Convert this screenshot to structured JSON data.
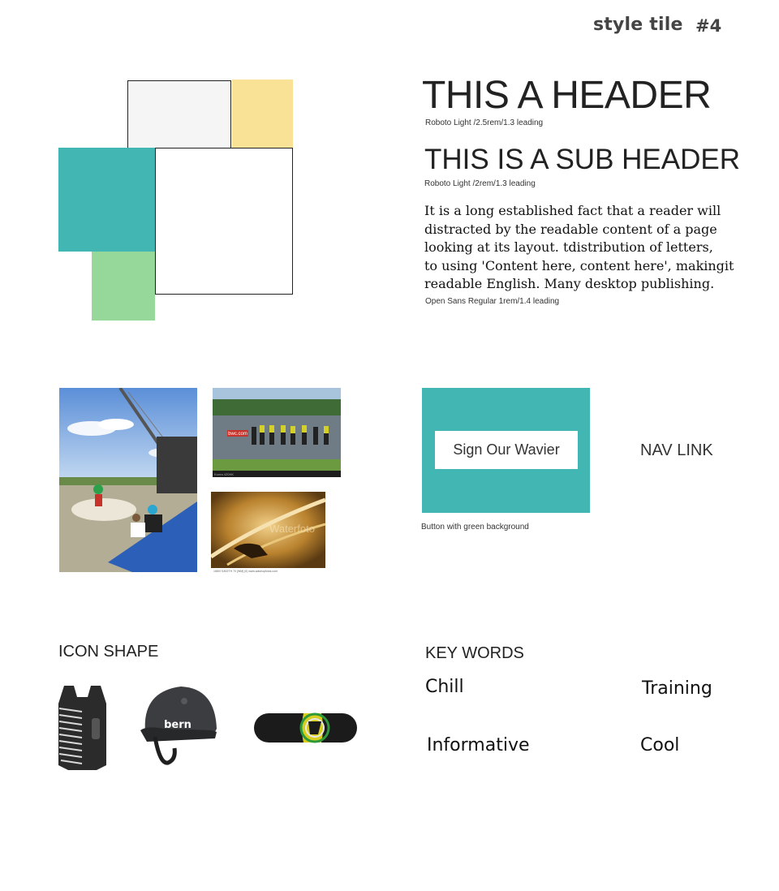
{
  "header": {
    "title": "style tile",
    "number": "#4"
  },
  "colors": {
    "light_gray": "#f5f5f5",
    "yellow": "#f9e196",
    "teal": "#41b6b3",
    "white": "#ffffff",
    "green": "#96d89a",
    "button_bg": "#41b6b3"
  },
  "typography": {
    "header_text": "THIS A HEADER",
    "header_note": "Roboto Light /2.5rem/1.3 leading",
    "subheader_text": "THIS IS A SUB HEADER",
    "subheader_note": "Roboto Light /2rem/1.3 leading",
    "body_lines": [
      "It is a long established fact that a reader will",
      "distracted by the readable content of a page",
      "looking at its layout. tdistribution of letters,",
      "to using 'Content here, content here', makingit",
      "readable English. Many desktop publishing."
    ],
    "body_note": "Open Sans Regular 1rem/1.4 leading"
  },
  "photos": {
    "tower_banner": "bwc.com",
    "tower_caption": "Korea 420HK",
    "surf_watermark": "Waterfoto",
    "surf_caption": "16807/1802TH 70 [WM] (0) www.wakeupfotos.com"
  },
  "button": {
    "label": "Sign Our Wavier",
    "caption": "Button with green background"
  },
  "nav": {
    "label": "NAV LINK"
  },
  "icons": {
    "title": "ICON SHAPE",
    "items": [
      "vest-icon",
      "helmet-icon",
      "wakeboard-icon"
    ],
    "helmet_brand": "bern"
  },
  "keywords": {
    "title": "KEY WORDS",
    "items": [
      "Chill",
      "Training",
      "Informative",
      "Cool"
    ]
  }
}
